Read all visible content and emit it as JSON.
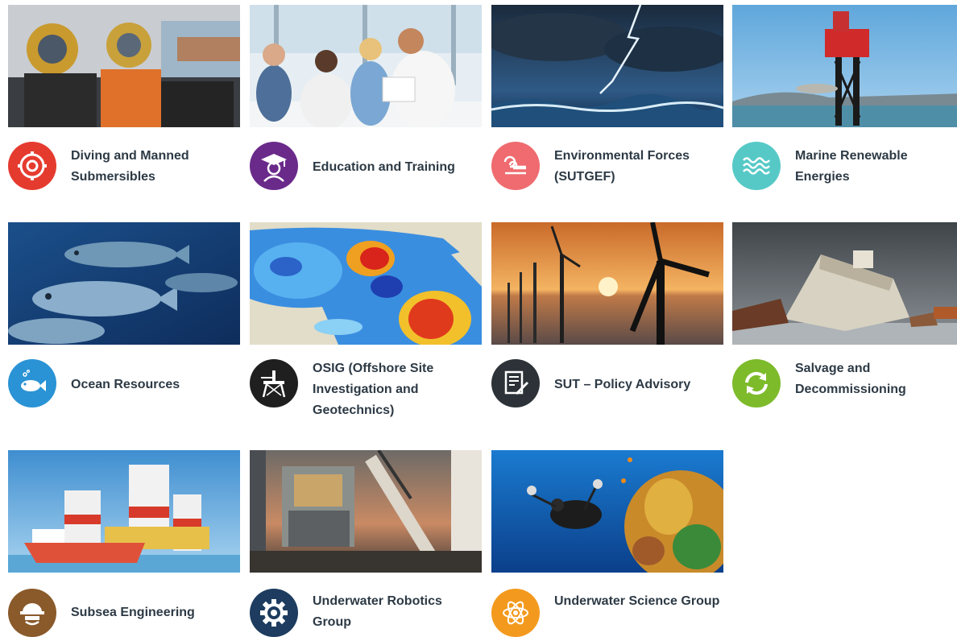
{
  "categories": [
    {
      "title": "Diving and Manned Submersibles",
      "icon": "diving-helmet-icon",
      "icon_color": "#e53b2f",
      "photo": "divers-in-helmets"
    },
    {
      "title": "Education and Training",
      "icon": "graduate-icon",
      "icon_color": "#6a2a8a",
      "photo": "meeting-room"
    },
    {
      "title": "Environmental Forces (SUTGEF)",
      "icon": "wind-waves-icon",
      "icon_color": "#ef6b6f",
      "photo": "lightning-storm-sea"
    },
    {
      "title": "Marine Renewable Energies",
      "icon": "waves-icon",
      "icon_color": "#56c9c7",
      "photo": "tidal-turbine-platform"
    },
    {
      "title": "Ocean Resources",
      "icon": "fish-icon",
      "icon_color": "#2a93d5",
      "photo": "school-of-fish"
    },
    {
      "title": "OSIG (Offshore Site Investigation and Geotechnics)",
      "icon": "offshore-rig-icon",
      "icon_color": "#1f1f1f",
      "photo": "ocean-temperature-map"
    },
    {
      "title": "SUT – Policy Advisory",
      "icon": "document-pen-icon",
      "icon_color": "#2c3238",
      "photo": "offshore-wind-sunset"
    },
    {
      "title": "Salvage and Decommissioning",
      "icon": "recycle-arrows-icon",
      "icon_color": "#7dbb2b",
      "photo": "shipwreck"
    },
    {
      "title": "Subsea Engineering",
      "icon": "engineer-hardhat-icon",
      "icon_color": "#8a5a2b",
      "photo": "heavy-lift-vessel"
    },
    {
      "title": "Underwater Robotics Group",
      "icon": "gear-icon",
      "icon_color": "#1d3c5f",
      "photo": "rov-launch-deck"
    },
    {
      "title": "Underwater Science Group",
      "icon": "atom-icon",
      "icon_color": "#f39a1e",
      "photo": "diver-coral-reef"
    }
  ]
}
